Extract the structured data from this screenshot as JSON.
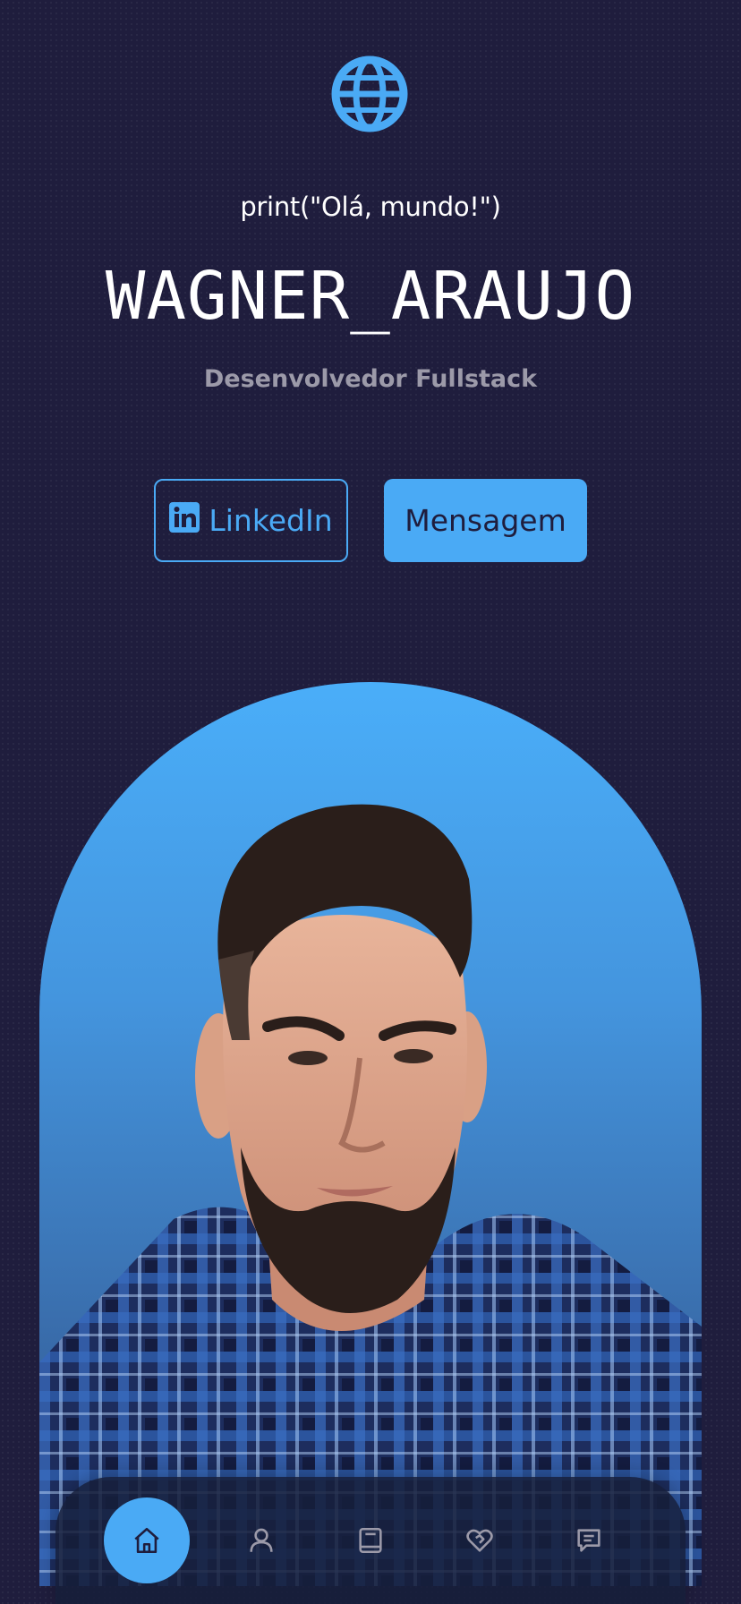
{
  "header": {
    "globe_icon": "globe-icon",
    "greeting": "print(\"Olá, mundo!\")",
    "name": "WAGNER_ARAUJO",
    "role": "Desenvolvedor Fullstack"
  },
  "actions": {
    "linkedin_label": "LinkedIn",
    "linkedin_icon": "linkedin-icon",
    "message_label": "Mensagem"
  },
  "colors": {
    "background": "#1f1d3d",
    "accent": "#4aaaf5",
    "muted_text": "#9c9aa9"
  },
  "bottom_nav": {
    "items": [
      {
        "icon": "home-icon",
        "active": true
      },
      {
        "icon": "user-icon",
        "active": false
      },
      {
        "icon": "book-icon",
        "active": false
      },
      {
        "icon": "heart-handshake-icon",
        "active": false
      },
      {
        "icon": "message-icon",
        "active": false
      }
    ]
  }
}
